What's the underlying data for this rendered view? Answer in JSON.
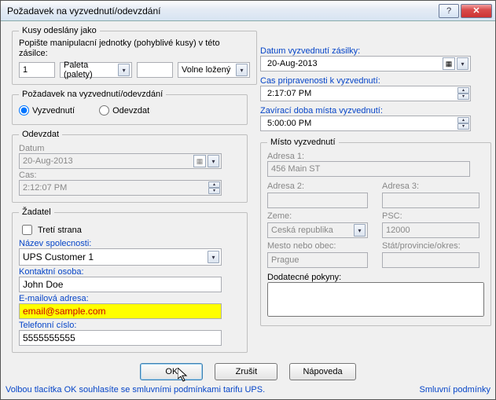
{
  "title": "Požadavek na vyzvednutí/odevzdání",
  "left": {
    "kusy": {
      "legend": "Kusy odeslány jako",
      "desc": "Popište manipulacní jednotky (pohyblivé kusy) v této zásilce:",
      "qty": "1",
      "type": "Paleta (palety)",
      "blank": "",
      "pack": "Volne ložený"
    },
    "request": {
      "legend": "Požadavek na vyzvednutí/odevzdání",
      "opt1": "Vyzvednutí",
      "opt2": "Odevzdat"
    },
    "odevzdat": {
      "legend": "Odevzdat",
      "datum_lbl": "Datum",
      "datum": "20-Aug-2013",
      "cas_lbl": "Cas:",
      "cas": "2:12:07 PM"
    },
    "zadatel": {
      "legend": "Žadatel",
      "treti": "Tretí strana",
      "nazev_lbl": "Název spolecnosti:",
      "nazev": "UPS Customer 1",
      "kontakt_lbl": "Kontaktní osoba:",
      "kontakt": "John Doe",
      "email_lbl": "E-mailová adresa:",
      "email": "email@sample.com",
      "tel_lbl": "Telefonní císlo:",
      "tel": "5555555555"
    }
  },
  "right": {
    "datum_lbl": "Datum vyzvednutí zásilky:",
    "datum": "20-Aug-2013",
    "cas_lbl": "Cas pripravenosti k vyzvednutí:",
    "cas": "2:17:07 PM",
    "zavir_lbl": "Zavírací doba místa vyzvednutí:",
    "zavir": "5:00:00 PM",
    "misto": {
      "legend": "Místo vyzvednutí",
      "a1_lbl": "Adresa 1:",
      "a1": "456 Main ST",
      "a2_lbl": "Adresa 2:",
      "a2": "",
      "a3_lbl": "Adresa 3:",
      "a3": "",
      "zeme_lbl": "Zeme:",
      "zeme": "Ceská republika",
      "psc_lbl": "PSC:",
      "psc": "12000",
      "mesto_lbl": "Mesto nebo obec:",
      "mesto": "Prague",
      "stat_lbl": "Stát/provincie/okres:",
      "stat": "",
      "pokyny_lbl": "Dodatecné pokyny:",
      "pokyny": ""
    }
  },
  "buttons": {
    "ok": "OK",
    "cancel": "Zrušit",
    "help": "Nápoveda"
  },
  "footer": {
    "left": "Volbou tlacítka OK souhlasíte se smluvními podmínkami tarifu UPS.",
    "right": "Smluvní podmínky"
  }
}
